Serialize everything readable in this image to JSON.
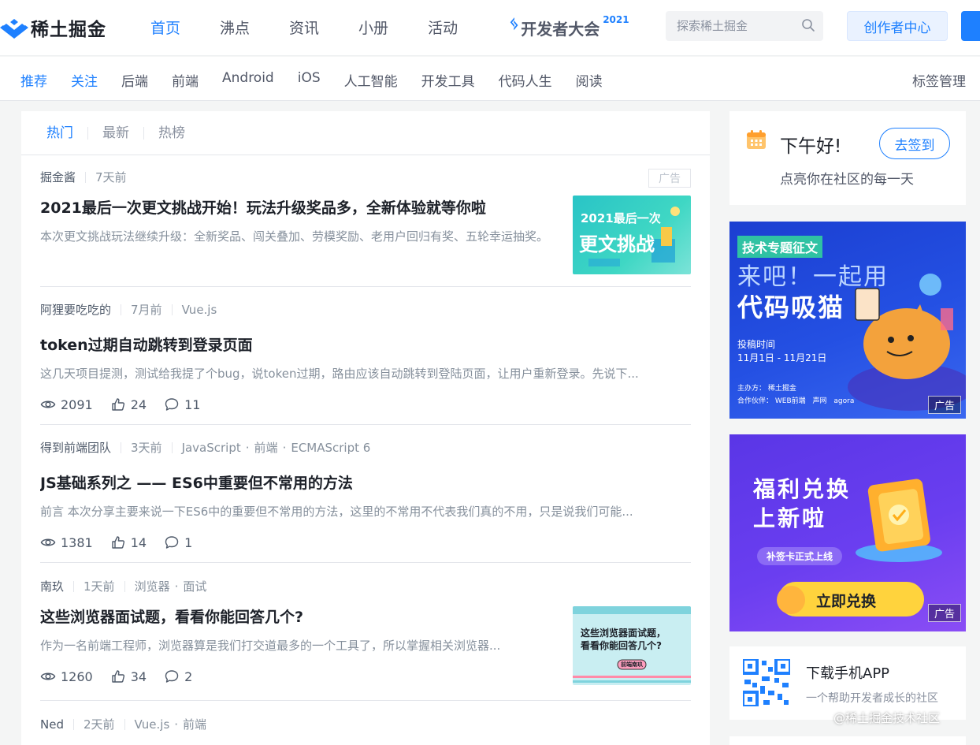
{
  "header": {
    "logo_text": "稀土掘金",
    "nav": [
      "首页",
      "沸点",
      "资讯",
      "小册",
      "活动"
    ],
    "conference": {
      "text": "开发者大会",
      "year": "2021"
    },
    "search_placeholder": "探索稀土掘金",
    "creator_button": "创作者中心"
  },
  "subnav": {
    "items": [
      "推荐",
      "关注",
      "后端",
      "前端",
      "Android",
      "iOS",
      "人工智能",
      "开发工具",
      "代码人生",
      "阅读"
    ],
    "tag_manage": "标签管理"
  },
  "feed": {
    "tabs": [
      "热门",
      "最新",
      "热榜"
    ],
    "entries": [
      {
        "author": "掘金酱",
        "time": "7天前",
        "tags": [],
        "ad_label": "广告",
        "title": "2021最后一次更文挑战开始！玩法升级奖品多，全新体验就等你啦",
        "abstract": "本次更文挑战玩法继续升级：全新奖品、闯关叠加、劳模奖励、老用户回归有奖、五轮幸运抽奖。",
        "thumb_text": [
          "2021最后一次",
          "更文挑战"
        ]
      },
      {
        "author": "阿狸要吃吃的",
        "time": "7月前",
        "tags": [
          "Vue.js"
        ],
        "title": "token过期自动跳转到登录页面",
        "abstract": "这几天项目提测，测试给我提了个bug，说token过期，路由应该自动跳转到登陆页面，让用户重新登录。先说下...",
        "views": "2091",
        "likes": "24",
        "comments": "11"
      },
      {
        "author": "得到前端团队",
        "time": "3天前",
        "tags": [
          "JavaScript",
          "前端",
          "ECMAScript 6"
        ],
        "title": "JS基础系列之 —— ES6中重要但不常用的方法",
        "abstract": "前言 本次分享主要来说一下ES6中的重要但不常用的方法，这里的不常用不代表我们真的不用，只是说我们可能...",
        "views": "1381",
        "likes": "14",
        "comments": "1"
      },
      {
        "author": "南玖",
        "time": "1天前",
        "tags": [
          "浏览器",
          "面试"
        ],
        "title": "这些浏览器面试题，看看你能回答几个?",
        "abstract": "作为一名前端工程师，浏览器算是我们打交道最多的一个工具了，所以掌握相关浏览器...",
        "views": "1260",
        "likes": "34",
        "comments": "2",
        "thumb_text": [
          "这些浏览器面试题，",
          "看看你能回答几个?",
          "前端南玖"
        ]
      },
      {
        "author": "Ned",
        "time": "2天前",
        "tags": [
          "Vue.js",
          "前端"
        ]
      }
    ]
  },
  "sidebar": {
    "greeting": "下午好!",
    "greeting_sub": "点亮你在社区的每一天",
    "signin_button": "去签到",
    "banner1": {
      "badge": "技术专题征文",
      "line1": "来吧！一起用",
      "line2": "代码吸猫",
      "period_label": "投稿时间",
      "period": "11月1日 - 11月21日",
      "host": "主办方：",
      "host_name": "稀土掘金",
      "partners": "合作伙伴：",
      "partner_names": [
        "WEB前端",
        "声网",
        "agora"
      ],
      "ad_label": "广告"
    },
    "banner2": {
      "line1": "福利兑换",
      "line2": "上新啦",
      "pill": "补签卡正式上线",
      "button": "立即兑换",
      "ad_label": "广告"
    },
    "app": {
      "title": "下载手机APP",
      "subtitle": "一个帮助开发者成长的社区"
    }
  },
  "watermark": "@稀土掘金技术社区",
  "colors": {
    "brand": "#1e80ff",
    "text": "#1d2129",
    "muted": "#86909c"
  }
}
